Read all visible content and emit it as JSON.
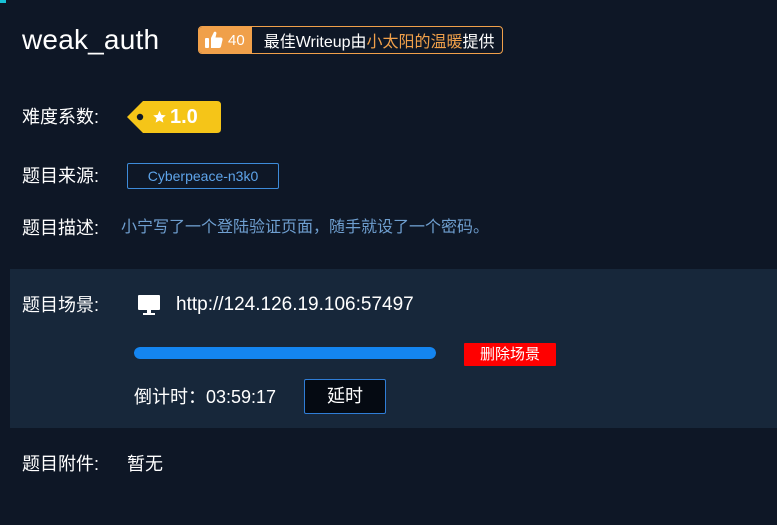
{
  "challenge": {
    "title": "weak_auth",
    "like_count": "40",
    "writeup_prefix": "最佳Writeup由",
    "writeup_author": "小太阳的温暖",
    "writeup_suffix": "提供"
  },
  "difficulty": {
    "label": "难度系数:",
    "value": "1.0",
    "tag_color": "#f5c518"
  },
  "source": {
    "label": "题目来源:",
    "value": "Cyberpeace-n3k0"
  },
  "description": {
    "label": "题目描述:",
    "text": "小宁写了一个登陆验证页面，随手就设了一个密码。"
  },
  "scene": {
    "label": "题目场景:",
    "url": "http://124.126.19.106:57497",
    "progress_fraction": 1.0,
    "delete_label": "删除场景",
    "countdown_text": "倒计时：03:59:17",
    "extend_label": "延时"
  },
  "attachment": {
    "label": "题目附件:",
    "value": "暂无"
  },
  "icons": {
    "like": "thumbs-up-icon",
    "monitor": "monitor-icon",
    "star": "star-icon"
  },
  "colors": {
    "background": "#0e1726",
    "panel": "#17273a",
    "accent_orange": "#f0a04a",
    "accent_blue": "#1485f0",
    "danger_red": "#ff0000",
    "description_text": "#6f9fd0"
  }
}
